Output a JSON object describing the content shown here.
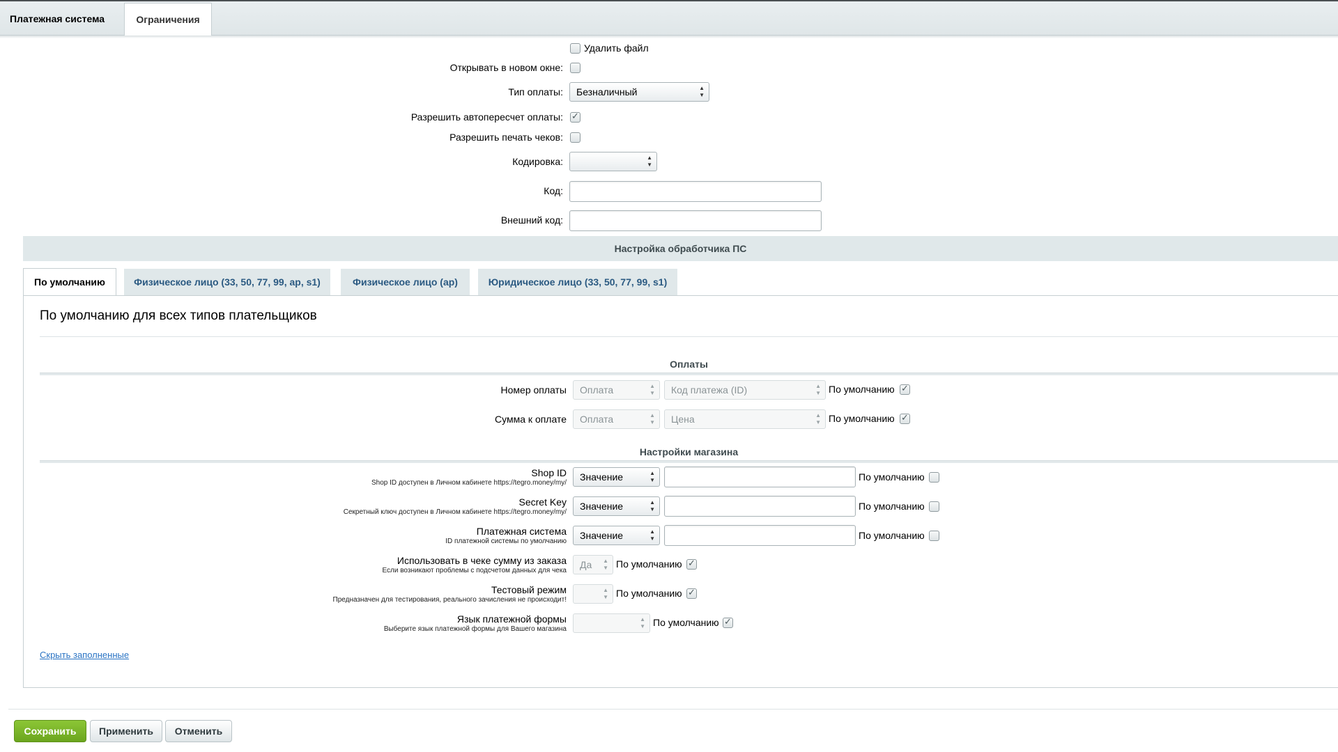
{
  "top_tabs": [
    "Платежная система",
    "Ограничения"
  ],
  "form": {
    "delete_file": "Удалить файл",
    "open_new_window": "Открывать в новом окне:",
    "payment_type_label": "Тип оплаты:",
    "payment_type_value": "Безналичный",
    "allow_recalc": "Разрешить автопересчет оплаты:",
    "allow_print": "Разрешить печать чеков:",
    "encoding_label": "Кодировка:",
    "encoding_value": "",
    "code_label": "Код:",
    "code_value": "",
    "ext_code_label": "Внешний код:",
    "ext_code_value": ""
  },
  "checkboxes": {
    "delete_file": false,
    "open_new_window": false,
    "allow_recalc": true,
    "allow_print": false
  },
  "section_title": "Настройка обработчика ПС",
  "inner_tabs": [
    "По умолчанию",
    "Физическое лицо (33, 50, 77, 99, ap, s1)",
    "Физическое лицо (ap)",
    "Юридическое лицо (33, 50, 77, 99, s1)"
  ],
  "panel_title": "По умолчанию для всех типов плательщиков",
  "payments": {
    "heading": "Оплаты",
    "rows": [
      {
        "label": "Номер оплаты",
        "type": "Оплата",
        "field": "Код платежа (ID)",
        "default": "По умолчанию",
        "default_checked": true
      },
      {
        "label": "Сумма к оплате",
        "type": "Оплата",
        "field": "Цена",
        "default": "По умолчанию",
        "default_checked": true
      }
    ]
  },
  "shop": {
    "heading": "Настройки магазина",
    "rows": [
      {
        "label": "Shop ID",
        "hint": "Shop ID доступен в Личном кабинете https://tegro.money/my/",
        "type": "Значение",
        "value": "",
        "default": "По умолчанию",
        "default_checked": false
      },
      {
        "label": "Secret Key",
        "hint": "Секретный ключ доступен в Личном кабинете https://tegro.money/my/",
        "type": "Значение",
        "value": "",
        "default": "По умолчанию",
        "default_checked": false
      },
      {
        "label": "Платежная система",
        "hint": "ID платежной системы по умолчанию",
        "type": "Значение",
        "value": "",
        "default": "По умолчанию",
        "default_checked": false
      },
      {
        "label": "Использовать в чеке сумму из заказа",
        "hint": "Если возникают проблемы с подсчетом данных для чека",
        "select": "Да",
        "default": "По умолчанию",
        "default_checked": true
      },
      {
        "label": "Тестовый режим",
        "hint": "Предназначен для тестирования, реального зачисления не происходит!",
        "select": "",
        "default": "По умолчанию",
        "default_checked": true
      },
      {
        "label": "Язык платежной формы",
        "hint": "Выберите язык платежной формы для Вашего магазина",
        "select": "",
        "default": "По умолчанию",
        "default_checked": true
      }
    ]
  },
  "hide_link": "Скрыть заполненные",
  "buttons": {
    "save": "Сохранить",
    "apply": "Применить",
    "cancel": "Отменить"
  },
  "colors": {
    "save_button": "#7ab62a",
    "link": "#2b74c4",
    "tab_text": "#2b5a82",
    "section_bg": "#e0e8ea"
  }
}
